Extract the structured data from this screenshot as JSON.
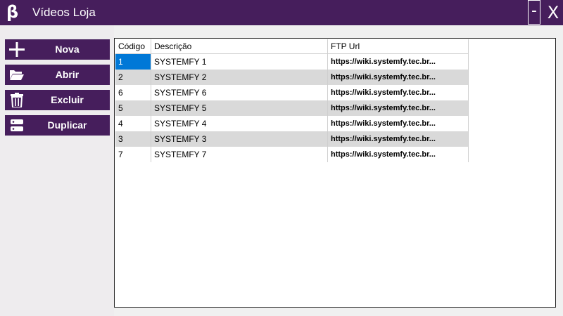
{
  "window": {
    "icon_glyph": "β",
    "title": "Vídeos Loja",
    "minimize_label": "-",
    "close_label": "X"
  },
  "sidebar": {
    "buttons": [
      {
        "label": "Nova",
        "icon": "plus-icon"
      },
      {
        "label": "Abrir",
        "icon": "folder-open-icon"
      },
      {
        "label": "Excluir",
        "icon": "trash-icon"
      },
      {
        "label": "Duplicar",
        "icon": "server-icon"
      }
    ]
  },
  "grid": {
    "columns": [
      "Código",
      "Descrição",
      "FTP Url"
    ],
    "rows": [
      {
        "code": "1",
        "desc": "SYSTEMFY 1",
        "url": "https://wiki.systemfy.tec.br..."
      },
      {
        "code": "2",
        "desc": "SYSTEMFY 2",
        "url": "https://wiki.systemfy.tec.br..."
      },
      {
        "code": "6",
        "desc": "SYSTEMFY 6",
        "url": "https://wiki.systemfy.tec.br..."
      },
      {
        "code": "5",
        "desc": "SYSTEMFY 5",
        "url": "https://wiki.systemfy.tec.br..."
      },
      {
        "code": "4",
        "desc": "SYSTEMFY 4",
        "url": "https://wiki.systemfy.tec.br..."
      },
      {
        "code": "3",
        "desc": "SYSTEMFY 3",
        "url": "https://wiki.systemfy.tec.br..."
      },
      {
        "code": "7",
        "desc": "SYSTEMFY 7",
        "url": "https://wiki.systemfy.tec.br..."
      }
    ]
  },
  "colors": {
    "accent": "#461e5c",
    "selection": "#0078d7",
    "alt_row": "#d9d9d9"
  }
}
